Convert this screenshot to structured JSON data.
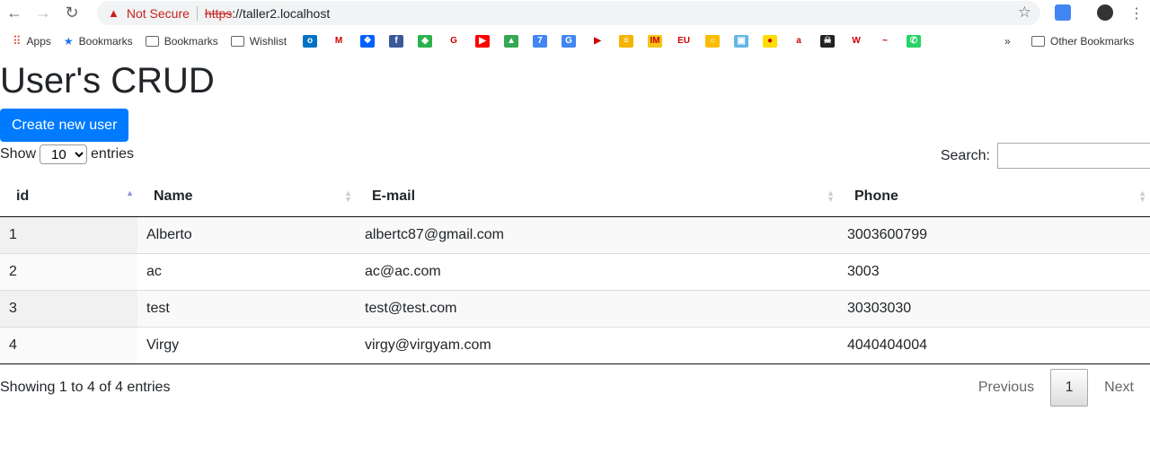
{
  "browser": {
    "url_scheme": "https",
    "url_rest": "://taller2.localhost",
    "security": "Not Secure"
  },
  "bookmarks": {
    "apps": "Apps",
    "items": [
      "Bookmarks",
      "Bookmarks",
      "Wishlist"
    ],
    "other": "Other Bookmarks",
    "more": "»",
    "icons": [
      {
        "n": "outlook",
        "c": "#0072c6",
        "g": "o"
      },
      {
        "n": "gmail",
        "c": "#ffffff",
        "g": "M"
      },
      {
        "n": "dropbox",
        "c": "#0061ff",
        "g": "❖"
      },
      {
        "n": "facebook",
        "c": "#3b5998",
        "g": "f"
      },
      {
        "n": "feedly",
        "c": "#2bb24c",
        "g": "◆"
      },
      {
        "n": "google",
        "c": "#ffffff",
        "g": "G"
      },
      {
        "n": "youtube",
        "c": "#ff0000",
        "g": "▶"
      },
      {
        "n": "drive",
        "c": "#34a853",
        "g": "▲"
      },
      {
        "n": "calendar",
        "c": "#4285f4",
        "g": "7"
      },
      {
        "n": "translate",
        "c": "#4285f4",
        "g": "G"
      },
      {
        "n": "play",
        "c": "#ffffff",
        "g": "▶"
      },
      {
        "n": "bank",
        "c": "#f4b400",
        "g": "≡"
      },
      {
        "n": "imdb",
        "c": "#f5c518",
        "g": "IM"
      },
      {
        "n": "eu",
        "c": "#ffffff",
        "g": "EU"
      },
      {
        "n": "keep",
        "c": "#fbbc04",
        "g": "○"
      },
      {
        "n": "shopping",
        "c": "#62b5e5",
        "g": "▣"
      },
      {
        "n": "app-red-dot",
        "c": "#ffdd00",
        "g": "●"
      },
      {
        "n": "amazon",
        "c": "#ffffff",
        "g": "a"
      },
      {
        "n": "pirate",
        "c": "#222222",
        "g": "☠"
      },
      {
        "n": "w",
        "c": "#ffffff",
        "g": "W"
      },
      {
        "n": "cinema",
        "c": "#ffffff",
        "g": "~"
      },
      {
        "n": "whatsapp",
        "c": "#25d366",
        "g": "✆"
      }
    ]
  },
  "page": {
    "title": "User's CRUD",
    "create_button": "Create new user",
    "show_label": "Show",
    "entries_value": "10",
    "entries_label": "entries",
    "search_label": "Search:",
    "search_value": ""
  },
  "table": {
    "headers": [
      "id",
      "Name",
      "E-mail",
      "Phone"
    ],
    "rows": [
      [
        "1",
        "Alberto",
        "albertc87@gmail.com",
        "3003600799"
      ],
      [
        "2",
        "ac",
        "ac@ac.com",
        "3003"
      ],
      [
        "3",
        "test",
        "test@test.com",
        "30303030"
      ],
      [
        "4",
        "Virgy",
        "virgy@virgyam.com",
        "4040404004"
      ]
    ]
  },
  "footer": {
    "info": "Showing 1 to 4 of 4 entries",
    "previous": "Previous",
    "current_page": "1",
    "next": "Next"
  }
}
